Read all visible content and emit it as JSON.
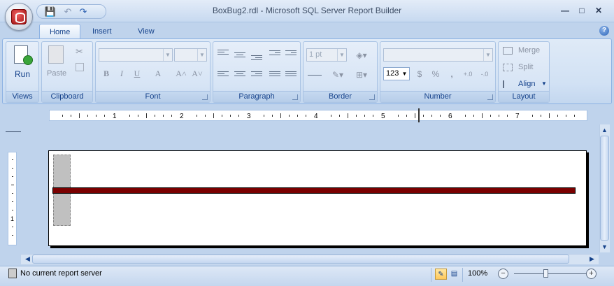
{
  "window": {
    "title": "BoxBug2.rdl - Microsoft SQL Server Report Builder",
    "minimize": "—",
    "maximize": "□",
    "close": "✕"
  },
  "quick_access": {
    "save": "💾",
    "undo": "↶",
    "redo": "↷"
  },
  "tabs": [
    {
      "label": "Home",
      "active": true
    },
    {
      "label": "Insert",
      "active": false
    },
    {
      "label": "View",
      "active": false
    }
  ],
  "help": "?",
  "ribbon": {
    "views": {
      "label": "Views",
      "run": "Run"
    },
    "clipboard": {
      "label": "Clipboard",
      "paste": "Paste"
    },
    "font": {
      "label": "Font",
      "bold": "B",
      "italic": "I",
      "underline": "U",
      "color": "A",
      "grow": "A˄",
      "shrink": "A˅"
    },
    "paragraph": {
      "label": "Paragraph"
    },
    "border": {
      "label": "Border",
      "width": "1 pt"
    },
    "number": {
      "label": "Number",
      "format": "123",
      "currency": "$",
      "percent": "%",
      "comma": ",",
      "inc_decimal": "+.0",
      "dec_decimal": "-.0"
    },
    "layout": {
      "label": "Layout",
      "merge": "Merge",
      "split": "Split",
      "align": "Align"
    }
  },
  "ruler": {
    "marks": [
      "1",
      "2",
      "3",
      "4",
      "5",
      "6",
      "7"
    ]
  },
  "vruler": {
    "mark": "1"
  },
  "status": {
    "server": "No current report server",
    "zoom": "100%",
    "zoom_out": "−",
    "zoom_in": "+"
  },
  "colors": {
    "accent": "#15428b",
    "bar": "#7a0000"
  }
}
